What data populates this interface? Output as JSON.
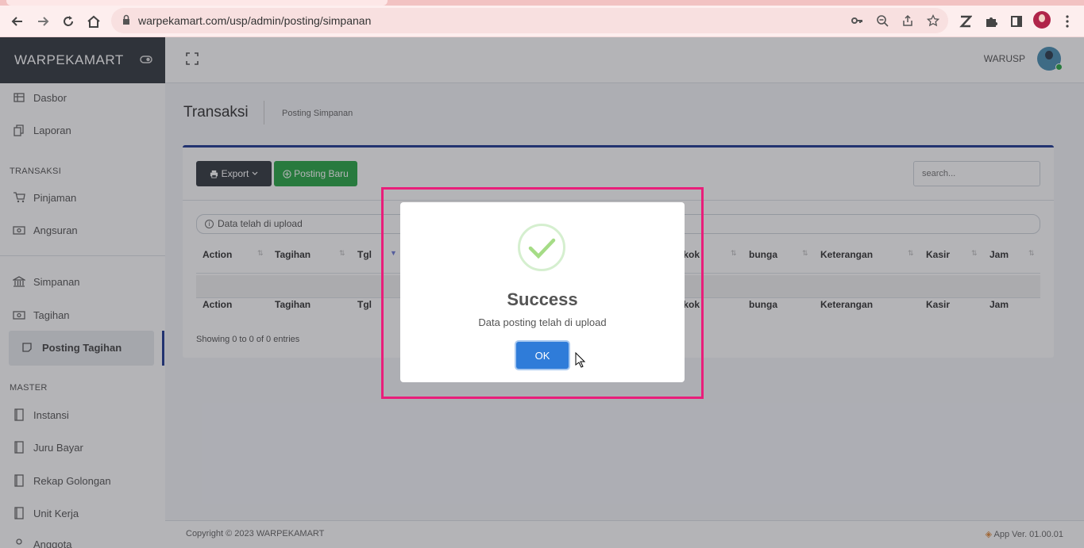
{
  "browser": {
    "url": "warpekamart.com/usp/admin/posting/simpanan",
    "icons": [
      "back-icon",
      "forward-icon",
      "reload-icon",
      "home-icon",
      "lock-icon",
      "key-icon",
      "zoom-icon",
      "share-icon",
      "star-icon",
      "z-extension-icon",
      "puzzle-icon",
      "sidebar-icon",
      "profile-avatar",
      "menu-icon"
    ]
  },
  "brand": {
    "name": "WARPEKAMART"
  },
  "header": {
    "user": "WARUSP"
  },
  "sidebar": {
    "items_top": [
      {
        "label": "Dasbor",
        "icon": "table-icon"
      },
      {
        "label": "Laporan",
        "icon": "copy-icon"
      }
    ],
    "transaksi_header": "TRANSAKSI",
    "transaksi_items": [
      {
        "label": "Pinjaman",
        "icon": "cart-icon"
      },
      {
        "label": "Angsuran",
        "icon": "money-icon"
      }
    ],
    "mid_items": [
      {
        "label": "Simpanan",
        "icon": "bank-icon"
      },
      {
        "label": "Tagihan",
        "icon": "money-icon"
      }
    ],
    "active_item": {
      "label": "Posting Tagihan",
      "icon": "note-icon"
    },
    "master_header": "MASTER",
    "master_items": [
      {
        "label": "Instansi",
        "icon": "book-icon"
      },
      {
        "label": "Juru Bayar",
        "icon": "book-icon"
      },
      {
        "label": "Rekap Golongan",
        "icon": "book-icon"
      },
      {
        "label": "Unit Kerja",
        "icon": "book-icon"
      },
      {
        "label": "Anggota",
        "icon": "user-icon"
      }
    ]
  },
  "content": {
    "title": "Transaksi",
    "breadcrumb": "Posting Simpanan",
    "export_label": "Export",
    "posting_label": "Posting Baru",
    "search_placeholder": "search...",
    "alert": "Data telah di upload",
    "columns_left": [
      "Action",
      "Tagihan",
      "Tgl"
    ],
    "columns_right": [
      "okok",
      "bunga",
      "Keterangan",
      "Kasir",
      "Jam"
    ],
    "showing": "Showing 0 to 0 of 0 entries"
  },
  "footer": {
    "copyright": "Copyright © 2023 WARPEKAMART",
    "version": "App Ver. 01.00.01"
  },
  "modal": {
    "title": "Success",
    "text": "Data posting telah di upload",
    "ok_label": "OK"
  }
}
